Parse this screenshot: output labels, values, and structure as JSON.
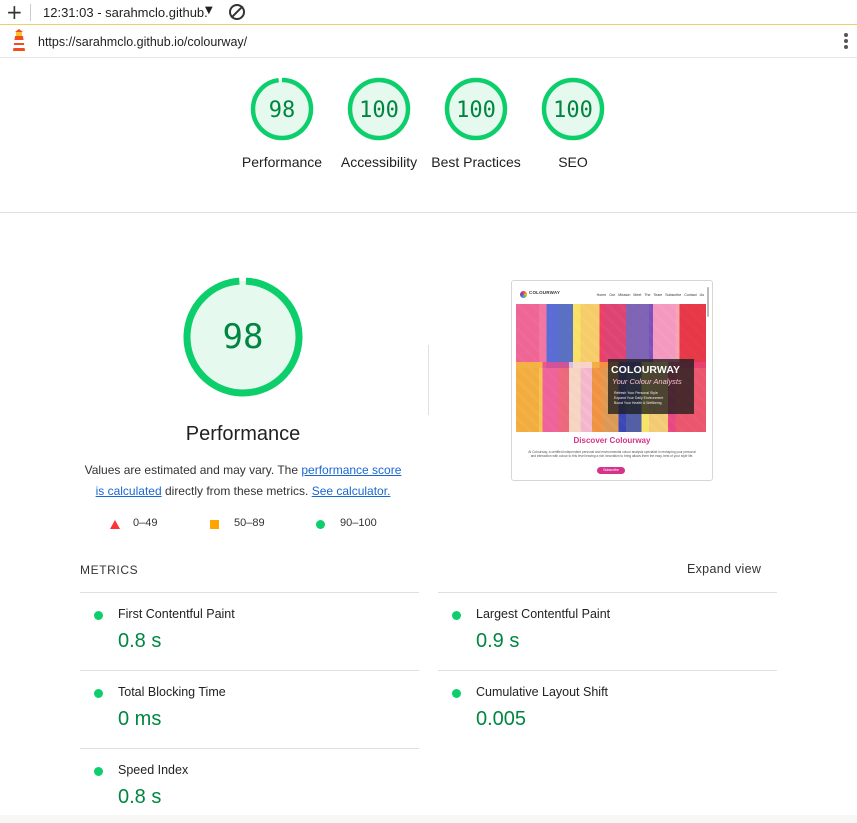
{
  "toolbar": {
    "report_label": "12:31:03 - sarahmclo.github.",
    "icons": [
      "plus-icon",
      "caret-down-icon",
      "clear-icon"
    ]
  },
  "urlbar": {
    "url": "https://sarahmclo.github.io/colourway/"
  },
  "categories": [
    {
      "score": "98",
      "score_value": 98,
      "label": "Performance"
    },
    {
      "score": "100",
      "score_value": 100,
      "label": "Accessibility"
    },
    {
      "score": "100",
      "score_value": 100,
      "label": "Best Practices"
    },
    {
      "score": "100",
      "score_value": 100,
      "label": "SEO"
    }
  ],
  "performance": {
    "score": "98",
    "score_value": 98,
    "title": "Performance",
    "desc_part1": "Values are estimated and may vary. The ",
    "desc_link1": "performance score is calculated",
    "desc_part2": " directly from these metrics. ",
    "desc_link2": "See calculator."
  },
  "legend": {
    "fail": "0–49",
    "average": "50–89",
    "pass": "90–100"
  },
  "thumbnail": {
    "brand": "COLOURWAY",
    "nav_links": "Home  Our Mission  Meet The Team  Subscribe  Contact Us",
    "hero_title": "COLOURWAY",
    "hero_subtitle": "Your Colour Analysts",
    "hero_bullets": [
      "Refresh Your Personal Style",
      "Expand Your Daily Environment",
      "Boost Your Health & Wellbeing"
    ],
    "heading": "Discover Colourway",
    "body": "At Colourway, a certified independent personal and environmental colour analysis specialist in reshaping your personal and interaction with colour to this level leaving a rich innovation to bring allows them the easy, best of your style life.",
    "button": "Subscribe"
  },
  "metrics": {
    "heading": "METRICS",
    "expand_label": "Expand view",
    "items": [
      {
        "name": "First Contentful Paint",
        "value": "0.8 s",
        "status": "pass"
      },
      {
        "name": "Largest Contentful Paint",
        "value": "0.9 s",
        "status": "pass"
      },
      {
        "name": "Total Blocking Time",
        "value": "0 ms",
        "status": "pass"
      },
      {
        "name": "Cumulative Layout Shift",
        "value": "0.005",
        "status": "pass"
      },
      {
        "name": "Speed Index",
        "value": "0.8 s",
        "status": "pass"
      }
    ]
  },
  "colors": {
    "pass": "#0cce6b",
    "pass_text": "#018642",
    "gauge_fill": "#e6f9ee",
    "average": "#ffa400",
    "fail": "#ff3333",
    "link": "#1967d2"
  }
}
